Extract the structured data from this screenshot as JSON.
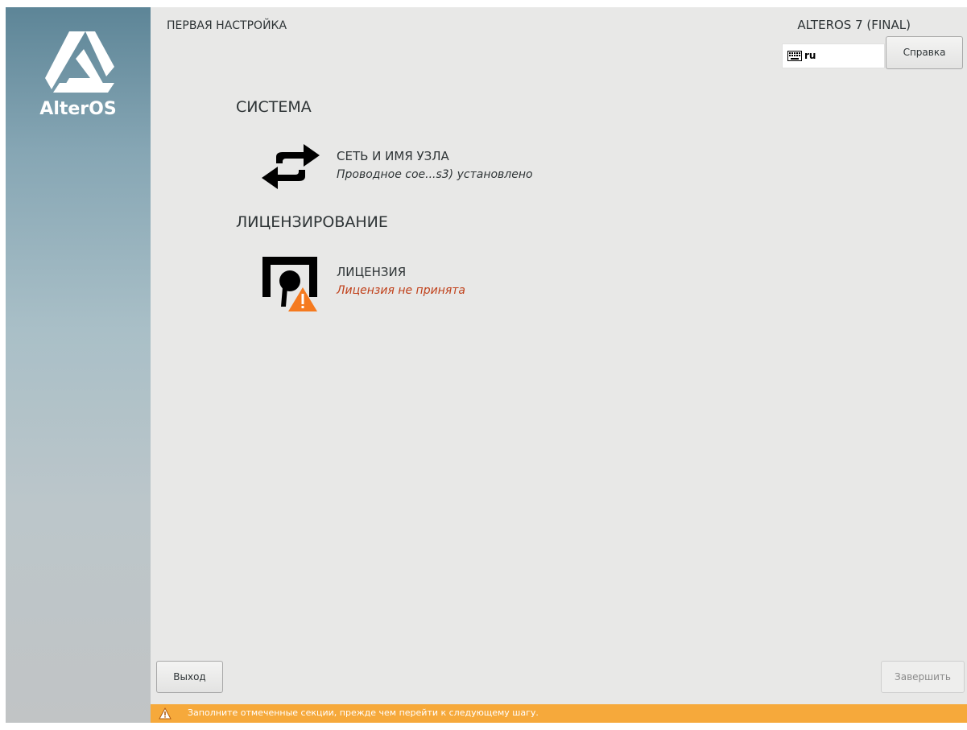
{
  "branding": {
    "logo_text": "AlterOS"
  },
  "header": {
    "page_title": "ПЕРВАЯ НАСТРОЙКА",
    "product_name": "ALTEROS 7 (FINAL)",
    "keyboard_layout": "ru",
    "help_label": "Справка"
  },
  "sections": {
    "system": {
      "title": "СИСТЕМА",
      "network": {
        "title": "СЕТЬ И ИМЯ УЗЛА",
        "status": "Проводное сое...s3) установлено",
        "icon": "network-arrows-icon"
      }
    },
    "licensing": {
      "title": "ЛИЦЕНЗИРОВАНИЕ",
      "license": {
        "title": "ЛИЦЕНЗИЯ",
        "status": "Лицензия не принята",
        "icon": "license-warning-icon"
      }
    }
  },
  "footer": {
    "quit_label": "Выход",
    "finish_label": "Завершить",
    "warning_text": "Заполните отмеченные секции, прежде чем перейти к следующему шагу."
  },
  "colors": {
    "warning_bar": "#f6a93b",
    "status_warning": "#c0401a",
    "main_background": "#e8e8e7"
  }
}
